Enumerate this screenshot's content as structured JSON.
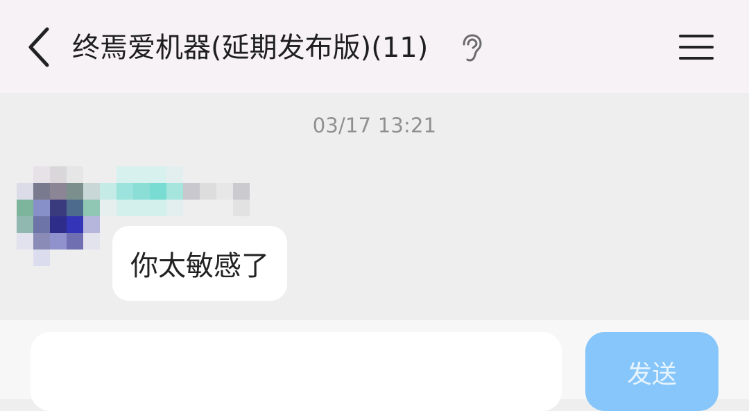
{
  "header": {
    "title": "终焉爱机器(延期发布版)(11)",
    "back_icon": "chevron-left-icon",
    "ear_icon": "ear-icon",
    "menu_icon": "hamburger-menu-icon"
  },
  "chat": {
    "timestamp": "03/17 13:21",
    "messages": [
      {
        "sender_visibility": "pixelated",
        "text": "你太敏感了"
      }
    ]
  },
  "input_bar": {
    "input_value": "",
    "send_label": "发送"
  },
  "colors": {
    "header_bg": "#f6f2f6",
    "chat_bg": "#eeeeee",
    "bubble_bg": "#ffffff",
    "send_button_bg": "#86c6fa",
    "send_button_text": "#e8f4fe",
    "timestamp_text": "#8f8f8f"
  }
}
